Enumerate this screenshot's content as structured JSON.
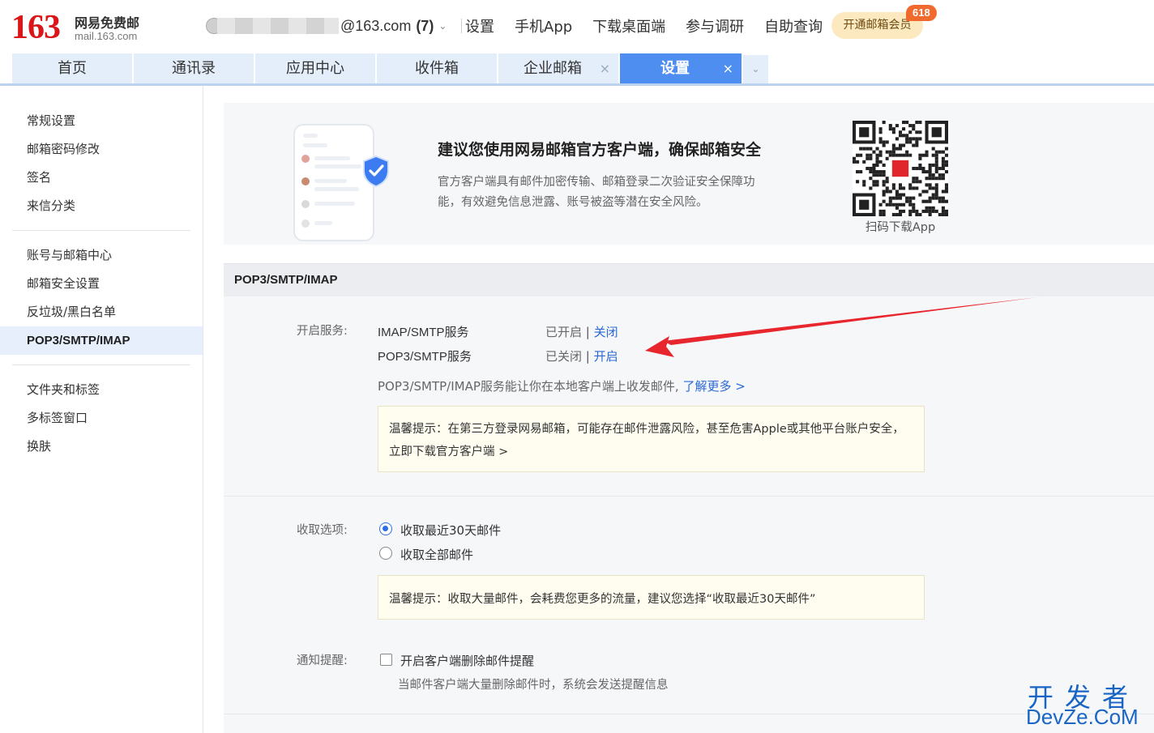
{
  "header": {
    "logo_number": "163",
    "logo_cn": "网易免费邮",
    "logo_domain": "mail.163.com",
    "account_email": "@163.com",
    "account_unread": "(7)",
    "nav": [
      "设置",
      "手机App",
      "下载桌面端",
      "参与调研",
      "自助查询"
    ],
    "vip_button": "开通邮箱会员",
    "vip_badge": "618"
  },
  "tabs": [
    {
      "label": "首页",
      "active": false,
      "closable": false
    },
    {
      "label": "通讯录",
      "active": false,
      "closable": false
    },
    {
      "label": "应用中心",
      "active": false,
      "closable": false
    },
    {
      "label": "收件箱",
      "active": false,
      "closable": false
    },
    {
      "label": "企业邮箱",
      "active": false,
      "closable": true
    },
    {
      "label": "设置",
      "active": true,
      "closable": true
    }
  ],
  "sidebar": {
    "group1": [
      "常规设置",
      "邮箱密码修改",
      "签名",
      "来信分类"
    ],
    "group2": [
      "账号与邮箱中心",
      "邮箱安全设置",
      "反垃圾/黑白名单",
      "POP3/SMTP/IMAP"
    ],
    "group3": [
      "文件夹和标签",
      "多标签窗口",
      "换肤"
    ],
    "active": "POP3/SMTP/IMAP"
  },
  "promo": {
    "title": "建议您使用网易邮箱官方客户端，确保邮箱安全",
    "text_line1": "官方客户端具有邮件加密传输、邮箱登录二次验证安全保障功",
    "text_line2": "能，有效避免信息泄露、账号被盗等潜在安全风险。",
    "qr_label": "扫码下载App"
  },
  "section": {
    "title": "POP3/SMTP/IMAP",
    "services_label": "开启服务:",
    "services": [
      {
        "name": "IMAP/SMTP服务",
        "status": "已开启",
        "action": "关闭"
      },
      {
        "name": "POP3/SMTP服务",
        "status": "已关闭",
        "action": "开启"
      }
    ],
    "services_desc": "POP3/SMTP/IMAP服务能让你在本地客户端上收发邮件,",
    "learn_more": "了解更多 >",
    "tip1_line1": "温馨提示：在第三方登录网易邮箱，可能存在邮件泄露风险，甚至危害Apple或其他平台账户安全，",
    "tip1_link": "立即下载官方客户端 >",
    "fetch_label": "收取选项:",
    "fetch_options": [
      "收取最近30天邮件",
      "收取全部邮件"
    ],
    "fetch_selected": "收取最近30天邮件",
    "tip2": "温馨提示：收取大量邮件，会耗费您更多的流量，建议您选择“收取最近30天邮件”",
    "notify_label": "通知提醒:",
    "notify_option": "开启客户端删除邮件提醒",
    "notify_checked": false,
    "notify_desc": "当邮件客户端大量删除邮件时，系统会发送提醒信息"
  },
  "watermark": {
    "cn": "开发者",
    "en": "DevZe.CoM"
  },
  "colors": {
    "brand_red": "#d9161a",
    "tab_active": "#4d8ef0",
    "link": "#2968d4",
    "annotation_arrow": "#e8262d"
  }
}
